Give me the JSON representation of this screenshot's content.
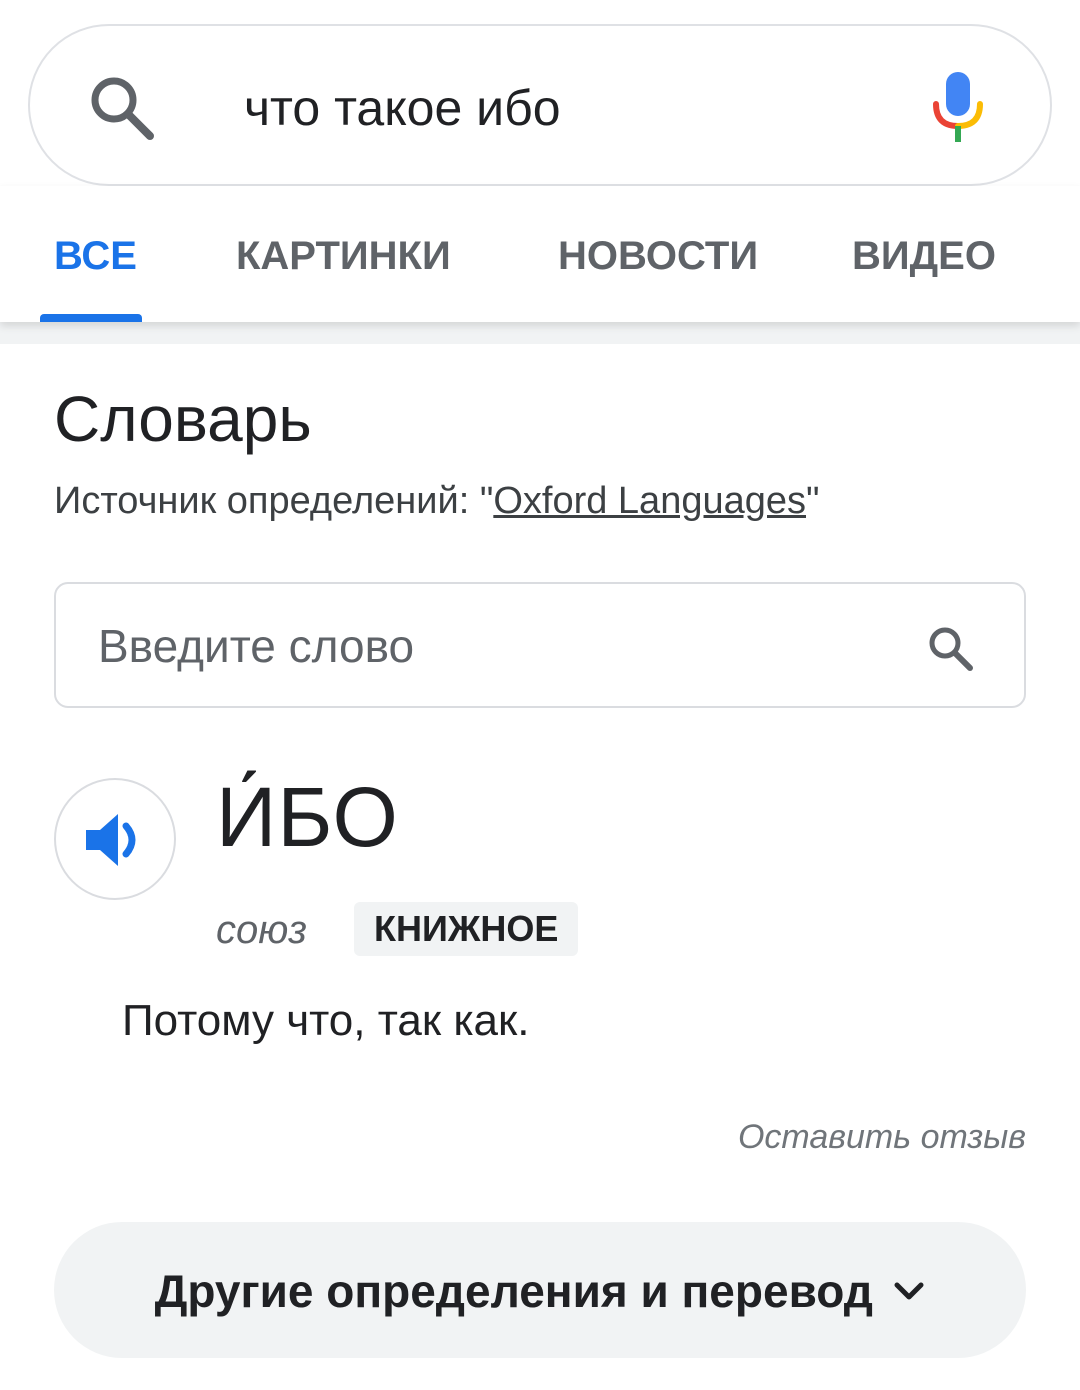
{
  "search": {
    "query": "что такое ибо"
  },
  "tabs": [
    {
      "label": "ВСЕ",
      "active": true
    },
    {
      "label": "КАРТИНКИ",
      "active": false
    },
    {
      "label": "НОВОСТИ",
      "active": false
    },
    {
      "label": "ВИДЕО",
      "active": false
    }
  ],
  "dictionary": {
    "title": "Словарь",
    "source_prefix": "Источник определений: \"",
    "source_link": "Oxford Languages",
    "source_suffix": "\"",
    "word_search_placeholder": "Введите слово",
    "headword": "И́БО",
    "part_of_speech": "союз",
    "register": "КНИЖНОЕ",
    "definition": "Потому что, так как.",
    "feedback": "Оставить отзыв",
    "more_button": "Другие определения и перевод"
  },
  "colors": {
    "accent": "#1a73e8",
    "mic_blue": "#4285f4",
    "mic_red": "#ea4335",
    "mic_yellow": "#fbbc05",
    "mic_green": "#34a853"
  }
}
